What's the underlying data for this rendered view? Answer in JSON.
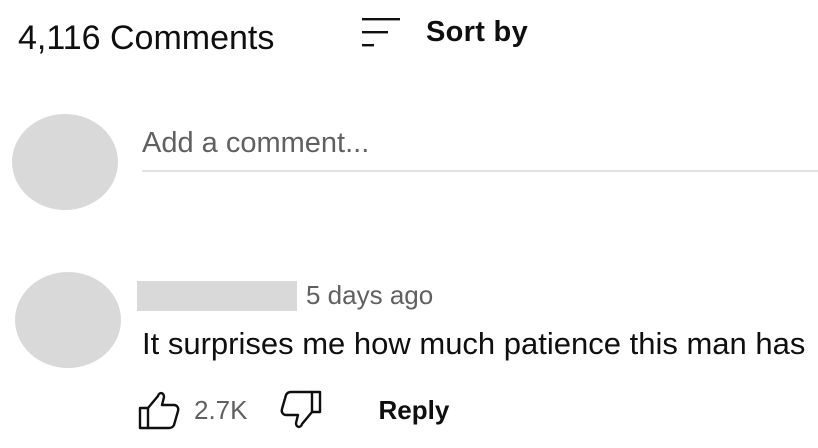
{
  "comments_header": {
    "count_text": "4,116 Comments",
    "sort_icon": "sort-icon",
    "sort_label": "Sort by"
  },
  "add_comment": {
    "placeholder": "Add a comment..."
  },
  "comment": {
    "author": "",
    "timestamp": "5 days ago",
    "text": "It surprises me how much patience this man has",
    "like_count": "2.7K",
    "like_icon": "thumbs-up-icon",
    "dislike_icon": "thumbs-down-icon",
    "reply_label": "Reply"
  },
  "colors": {
    "primary_text": "#0f0f0f",
    "secondary_text": "#606060",
    "placeholder_gray": "#d9d9d9",
    "divider": "#e2e2e2"
  }
}
